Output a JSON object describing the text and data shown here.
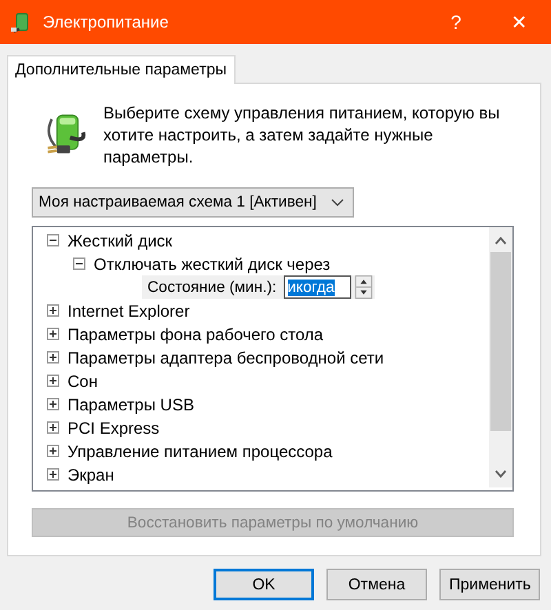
{
  "window": {
    "title": "Электропитание",
    "help": "?",
    "close": "✕"
  },
  "tabs": [
    {
      "label": "Дополнительные параметры",
      "selected": true
    }
  ],
  "intro": "Выберите схему управления питанием, которую вы хотите настроить, а затем задайте нужные параметры.",
  "scheme_dropdown": {
    "value": "Моя настраиваемая схема 1 [Активен]"
  },
  "tree": [
    {
      "kind": "group",
      "label": "Жесткий диск",
      "expanded": true,
      "children": [
        {
          "kind": "group",
          "label": "Отключать жесткий диск через",
          "expanded": true,
          "children": [
            {
              "kind": "setting",
              "label": "Состояние (мин.):",
              "value": "икогда"
            }
          ]
        }
      ]
    },
    {
      "kind": "group",
      "label": "Internet Explorer",
      "expanded": false
    },
    {
      "kind": "group",
      "label": "Параметры фона рабочего стола",
      "expanded": false
    },
    {
      "kind": "group",
      "label": "Параметры адаптера беспроводной сети",
      "expanded": false
    },
    {
      "kind": "group",
      "label": "Сон",
      "expanded": false
    },
    {
      "kind": "group",
      "label": "Параметры USB",
      "expanded": false
    },
    {
      "kind": "group",
      "label": "PCI Express",
      "expanded": false
    },
    {
      "kind": "group",
      "label": "Управление питанием процессора",
      "expanded": false
    },
    {
      "kind": "group",
      "label": "Экран",
      "expanded": false
    }
  ],
  "restore_button": {
    "label": "Восстановить параметры по умолчанию",
    "disabled": true
  },
  "buttons": [
    {
      "label": "OK",
      "selected": true
    },
    {
      "label": "Отмена",
      "selected": false
    },
    {
      "label": "Применить",
      "selected": false
    }
  ]
}
